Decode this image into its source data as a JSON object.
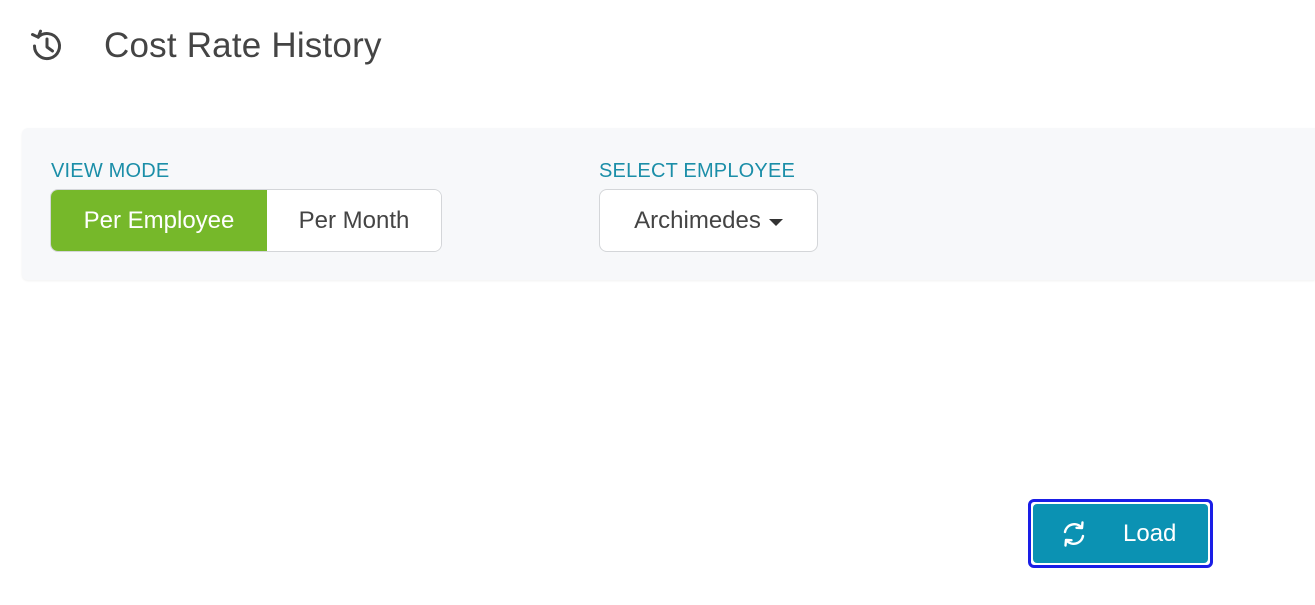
{
  "header": {
    "icon": "history-icon",
    "title": "Cost Rate History"
  },
  "filters": {
    "view_mode": {
      "label": "VIEW MODE",
      "options": [
        "Per Employee",
        "Per Month"
      ],
      "selected": "Per Employee"
    },
    "employee": {
      "label": "SELECT EMPLOYEE",
      "selected": "Archimedes",
      "icon": "caret-down-icon"
    }
  },
  "actions": {
    "load_label": "Load",
    "load_icon": "refresh-icon"
  },
  "colors": {
    "accent_teal": "#0b92b3",
    "label_teal": "#1b8ea8",
    "active_green": "#76b82a",
    "focus_ring": "#1a1ee6"
  }
}
